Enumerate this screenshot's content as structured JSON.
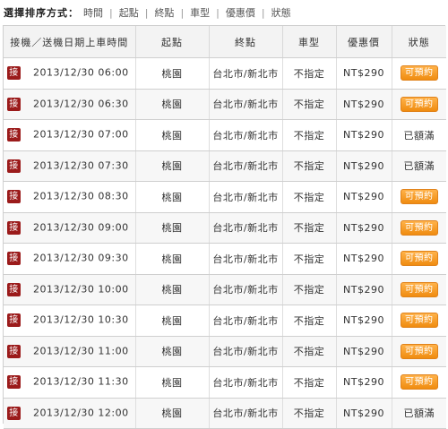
{
  "sort": {
    "label": "選擇排序方式：",
    "options": [
      "時間",
      "起點",
      "終點",
      "車型",
      "優惠價",
      "狀態"
    ]
  },
  "table": {
    "headers": [
      "接機／送機日期上車時間",
      "起點",
      "終點",
      "車型",
      "優惠價",
      "狀態"
    ],
    "badge": "接",
    "status_available": "可預約",
    "status_full": "已額滿",
    "rows": [
      {
        "datetime": "2013/12/30 06:00",
        "from": "桃園",
        "to": "台北市/新北市",
        "car": "不指定",
        "price": "NT$290",
        "available": true
      },
      {
        "datetime": "2013/12/30 06:30",
        "from": "桃園",
        "to": "台北市/新北市",
        "car": "不指定",
        "price": "NT$290",
        "available": true
      },
      {
        "datetime": "2013/12/30 07:00",
        "from": "桃園",
        "to": "台北市/新北市",
        "car": "不指定",
        "price": "NT$290",
        "available": false
      },
      {
        "datetime": "2013/12/30 07:30",
        "from": "桃園",
        "to": "台北市/新北市",
        "car": "不指定",
        "price": "NT$290",
        "available": false
      },
      {
        "datetime": "2013/12/30 08:30",
        "from": "桃園",
        "to": "台北市/新北市",
        "car": "不指定",
        "price": "NT$290",
        "available": true
      },
      {
        "datetime": "2013/12/30 09:00",
        "from": "桃園",
        "to": "台北市/新北市",
        "car": "不指定",
        "price": "NT$290",
        "available": true
      },
      {
        "datetime": "2013/12/30 09:30",
        "from": "桃園",
        "to": "台北市/新北市",
        "car": "不指定",
        "price": "NT$290",
        "available": true
      },
      {
        "datetime": "2013/12/30 10:00",
        "from": "桃園",
        "to": "台北市/新北市",
        "car": "不指定",
        "price": "NT$290",
        "available": true
      },
      {
        "datetime": "2013/12/30 10:30",
        "from": "桃園",
        "to": "台北市/新北市",
        "car": "不指定",
        "price": "NT$290",
        "available": true
      },
      {
        "datetime": "2013/12/30 11:00",
        "from": "桃園",
        "to": "台北市/新北市",
        "car": "不指定",
        "price": "NT$290",
        "available": true
      },
      {
        "datetime": "2013/12/30 11:30",
        "from": "桃園",
        "to": "台北市/新北市",
        "car": "不指定",
        "price": "NT$290",
        "available": true
      },
      {
        "datetime": "2013/12/30 12:00",
        "from": "桃園",
        "to": "台北市/新北市",
        "car": "不指定",
        "price": "NT$290",
        "available": false
      }
    ]
  },
  "colors": {
    "badge": "#9b1b1b",
    "button": "#f08c10"
  }
}
